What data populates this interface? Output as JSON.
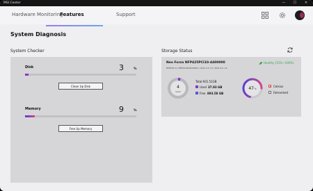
{
  "app": {
    "title": "MSI Center"
  },
  "window_controls": {
    "minimize": "—",
    "maximize": "☐",
    "close": "✕"
  },
  "nav": {
    "tabs": [
      {
        "label": "Hardware Monitoring",
        "active": false
      },
      {
        "label": "Features",
        "active": true
      },
      {
        "label": "Support",
        "active": false
      }
    ],
    "icons": [
      "grid-icon",
      "gear-icon",
      "user-avatar"
    ]
  },
  "page": {
    "title": "System Diagnosis"
  },
  "system_checker": {
    "title": "System Checker",
    "disk": {
      "label": "Disk",
      "value": "3",
      "unit": "%",
      "progress": 3,
      "color": "#8a37c4",
      "button": "Clean Up Disk"
    },
    "memory": {
      "label": "Memory",
      "value": "9",
      "unit": "%",
      "progress": 9,
      "colors": [
        "#5a3ed0",
        "#d44787"
      ],
      "button": "Free Up Memory"
    }
  },
  "storage": {
    "title": "Storage Status",
    "refresh_icon": "refresh-icon",
    "device": "Neo Forza NFP425PCI10-4400000",
    "details": "EFNX31.4 / NFP221904100022 / PCIe 4.0 ×4 / PCIe 4.0 ×4",
    "health": "Healthy (51%~100%)",
    "health_color": "#3aa64c",
    "used_pct": "4",
    "used_word": "Used",
    "total_label": "Total:931.51GB",
    "used_label": "Used",
    "used_value": "37.93 GB",
    "free_label": "Free",
    "free_value": "893.58 GB",
    "used_color": "#8a37c4",
    "free_color": "#5b55c9",
    "temperature": "47",
    "temperature_unit": "°c",
    "temp_colors": [
      "#d44787",
      "#5a3ed0"
    ],
    "units": [
      {
        "label": "Celsius",
        "checked": true
      },
      {
        "label": "Fahrenheit",
        "checked": false
      }
    ]
  }
}
